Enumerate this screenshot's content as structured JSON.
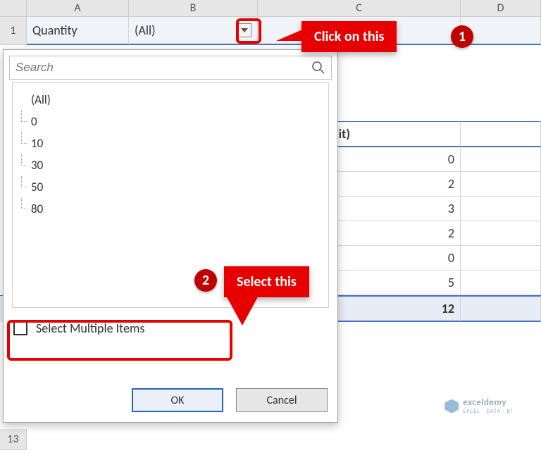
{
  "columns": {
    "A": "A",
    "B": "B",
    "C": "C",
    "D": "D"
  },
  "row1": {
    "num": "1",
    "label": "Quantity",
    "value": "(All)"
  },
  "row13": "13",
  "pivot": {
    "header_c": "f Price (Per Unit)",
    "values": [
      "0",
      "2",
      "3",
      "2",
      "0",
      "5"
    ],
    "total": "12"
  },
  "popup": {
    "search_placeholder": "Search",
    "items": [
      "(All)",
      "0",
      "10",
      "30",
      "50",
      "80"
    ],
    "multi_label": "Select Multiple Items",
    "ok": "OK",
    "cancel": "Cancel"
  },
  "callouts": {
    "c1": "Click on this",
    "c2": "Select this",
    "step1": "1",
    "step2": "2"
  },
  "watermark": {
    "brand": "exceldemy",
    "tag": "EXCEL · DATA · BI"
  }
}
